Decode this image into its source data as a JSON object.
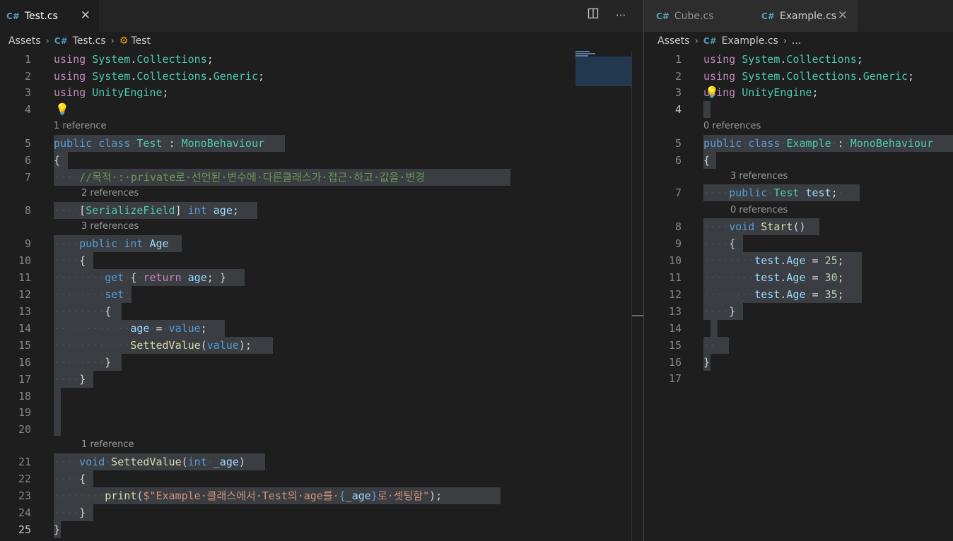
{
  "left": {
    "tab": {
      "label": "Test.cs",
      "close": "✕"
    },
    "actions": {
      "split": "split-editor",
      "more": "···"
    },
    "breadcrumb": {
      "root": "Assets",
      "file": "Test.cs",
      "symbol": "Test"
    },
    "code_lens": {
      "l5": "1 reference",
      "l8": "2 references",
      "l9": "3 references",
      "l21": "1 reference"
    },
    "lines": [
      "1",
      "2",
      "3",
      "4",
      "5",
      "6",
      "7",
      "8",
      "9",
      "10",
      "11",
      "12",
      "13",
      "14",
      "15",
      "16",
      "17",
      "18",
      "19",
      "20",
      "21",
      "22",
      "23",
      "24",
      "25"
    ]
  },
  "right": {
    "tabs": [
      {
        "label": "Cube.cs"
      },
      {
        "label": "Example.cs",
        "close": "✕"
      }
    ],
    "breadcrumb": {
      "root": "Assets",
      "file": "Example.cs",
      "more": "..."
    },
    "code_lens": {
      "l5": "0 references",
      "l7": "3 references",
      "l8": "0 references"
    },
    "lines": [
      "1",
      "2",
      "3",
      "4",
      "5",
      "6",
      "7",
      "8",
      "9",
      "10",
      "11",
      "12",
      "13",
      "14",
      "15",
      "16",
      "17"
    ]
  },
  "colors": {
    "background": "#1e1e1e",
    "selection": "#3a3d41",
    "keyword": "#c586c0",
    "builtin": "#569cd6",
    "type": "#4ec9b0",
    "variable": "#9cdcfe",
    "function": "#dcdcaa",
    "comment": "#6a9955",
    "string": "#ce9178",
    "number": "#b5cea8"
  },
  "icons": {
    "csharp": "C#-file-icon",
    "symbol": "class-symbol-icon",
    "bulb": "lightbulb-icon"
  }
}
